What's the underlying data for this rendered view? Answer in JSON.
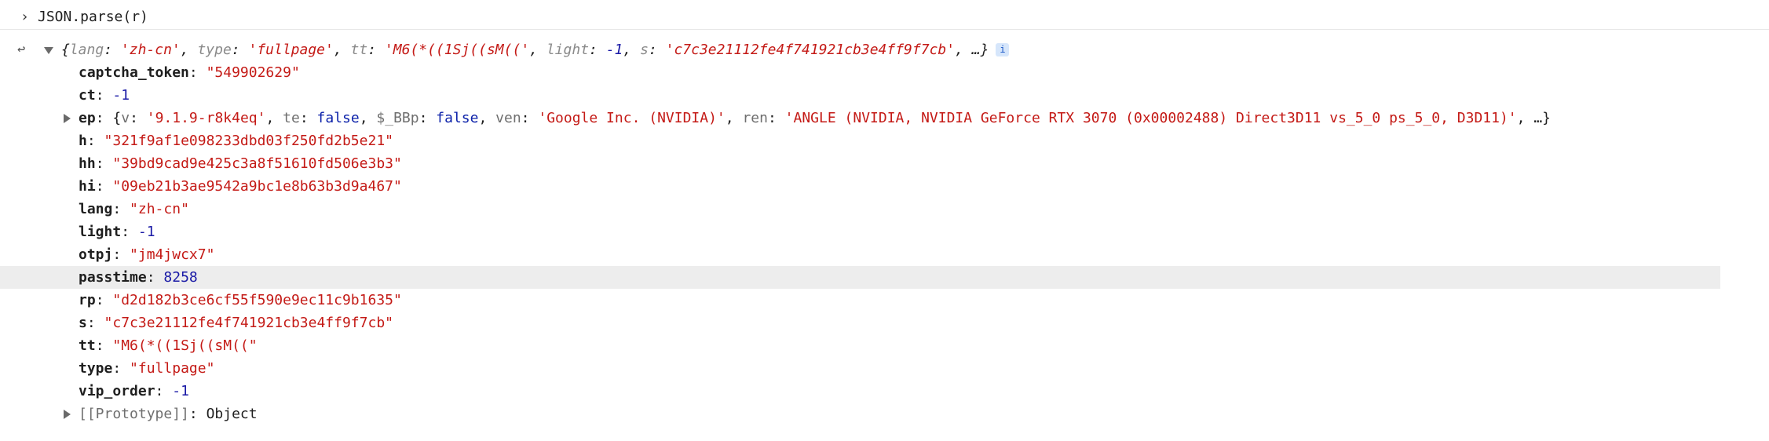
{
  "console": {
    "input": {
      "prompt_glyph": "›",
      "command": "JSON.parse(r)"
    },
    "result": {
      "back_arrow": "↩",
      "summary": {
        "open": "{",
        "entries": [
          {
            "key": "lang",
            "value": "'zh-cn'",
            "type": "string"
          },
          {
            "key": "type",
            "value": "'fullpage'",
            "type": "string"
          },
          {
            "key": "tt",
            "value": "'M6(*((1Sj((sM(('",
            "type": "string"
          },
          {
            "key": "light",
            "value": "-1",
            "type": "number"
          },
          {
            "key": "s",
            "value": "'c7c3e21112fe4f741921cb3e4ff9f7cb'",
            "type": "string"
          }
        ],
        "ellipsis": ", …}",
        "info": "i"
      },
      "properties": [
        {
          "key": "captcha_token",
          "value": "\"549902629\"",
          "type": "string"
        },
        {
          "key": "ct",
          "value": "-1",
          "type": "number"
        },
        {
          "key": "h",
          "value": "\"321f9af1e098233dbd03f250fd2b5e21\"",
          "type": "string"
        },
        {
          "key": "hh",
          "value": "\"39bd9cad9e425c3a8f51610fd506e3b3\"",
          "type": "string"
        },
        {
          "key": "hi",
          "value": "\"09eb21b3ae9542a9bc1e8b63b3d9a467\"",
          "type": "string"
        },
        {
          "key": "lang",
          "value": "\"zh-cn\"",
          "type": "string"
        },
        {
          "key": "light",
          "value": "-1",
          "type": "number"
        },
        {
          "key": "otpj",
          "value": "\"jm4jwcx7\"",
          "type": "string"
        },
        {
          "key": "passtime",
          "value": "8258",
          "type": "number"
        },
        {
          "key": "rp",
          "value": "\"d2d182b3ce6cf55f590e9ec11c9b1635\"",
          "type": "string"
        },
        {
          "key": "s",
          "value": "\"c7c3e21112fe4f741921cb3e4ff9f7cb\"",
          "type": "string"
        },
        {
          "key": "tt",
          "value": "\"M6(*((1Sj((sM((\"",
          "type": "string"
        },
        {
          "key": "type",
          "value": "\"fullpage\"",
          "type": "string"
        },
        {
          "key": "vip_order",
          "value": "-1",
          "type": "number"
        }
      ],
      "ep": {
        "key": "ep",
        "open": "{",
        "entries": [
          {
            "key": "v",
            "value": "'9.1.9-r8k4eq'",
            "type": "string"
          },
          {
            "key": "te",
            "value": "false",
            "type": "bool"
          },
          {
            "key": "$_BBp",
            "value": "false",
            "type": "bool"
          },
          {
            "key": "ven",
            "value": "'Google Inc. (NVIDIA)'",
            "type": "string"
          },
          {
            "key": "ren",
            "value": "'ANGLE (NVIDIA, NVIDIA GeForce RTX 3070 (0x00002488) Direct3D11 vs_5_0 ps_5_0, D3D11)'",
            "type": "string"
          }
        ],
        "ellipsis": ", …}"
      },
      "prototype": {
        "key": "[[Prototype]]",
        "value": "Object"
      }
    }
  },
  "colors": {
    "string": "#c41a16",
    "number": "#1a1aa6",
    "bool": "#0d22aa",
    "highlight_row": "#ededed"
  }
}
